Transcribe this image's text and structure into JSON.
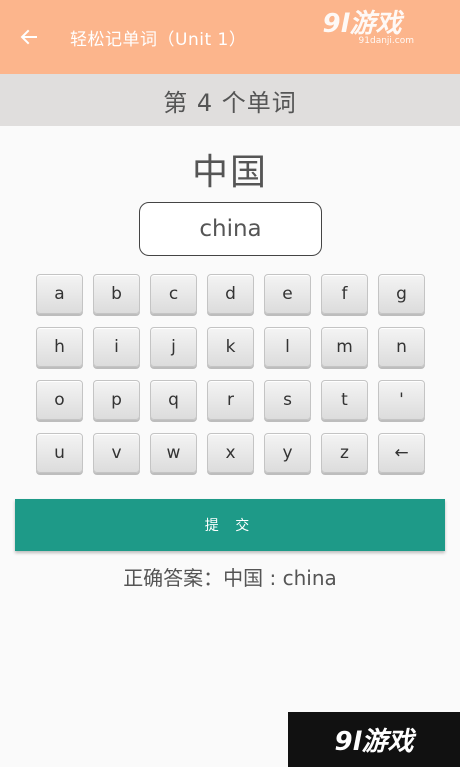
{
  "app_bar": {
    "title": "轻松记单词（Unit 1）",
    "back_icon": "arrow-left-icon",
    "background": "#fcb58c"
  },
  "watermark": {
    "top_main": "9l游戏",
    "top_sub": "91danji.com",
    "bottom": "9l游戏"
  },
  "word_index": "第 4 个单词",
  "chinese_word": "中国",
  "answer_input": "china",
  "keyboard": {
    "rows": [
      [
        "a",
        "b",
        "c",
        "d",
        "e",
        "f",
        "g"
      ],
      [
        "h",
        "i",
        "j",
        "k",
        "l",
        "m",
        "n"
      ],
      [
        "o",
        "p",
        "q",
        "r",
        "s",
        "t",
        "'"
      ],
      [
        "u",
        "v",
        "w",
        "x",
        "y",
        "z",
        "←"
      ]
    ]
  },
  "submit_label": "提 交",
  "correct_answer": "正确答案：中国 : china",
  "colors": {
    "accent": "#1e9a88",
    "header_band": "#e0dedd"
  }
}
